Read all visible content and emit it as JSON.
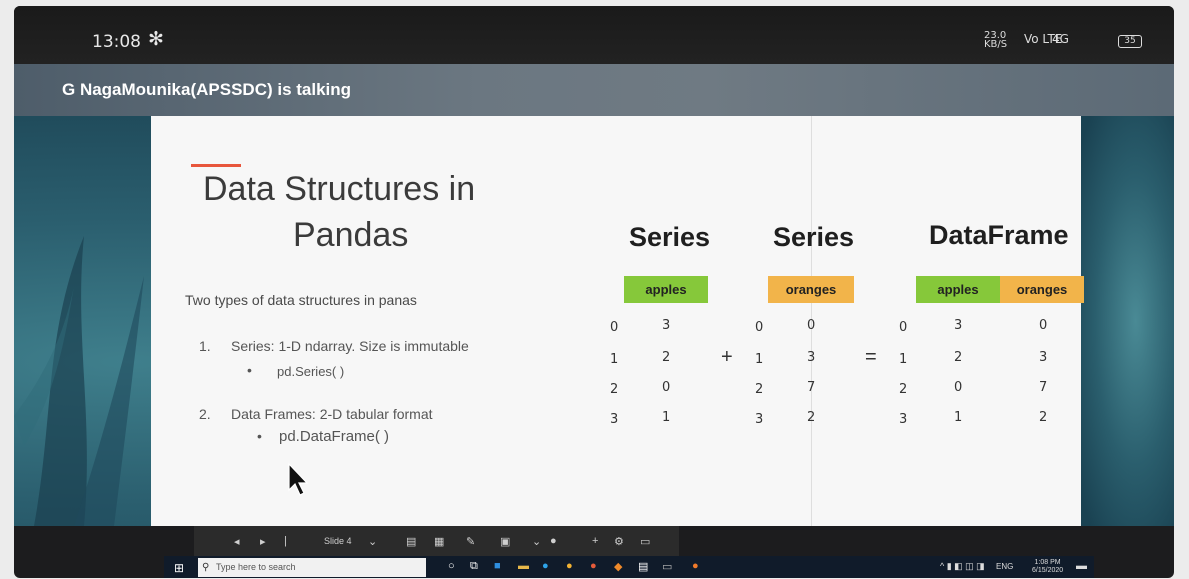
{
  "status_bar": {
    "time": "13:08",
    "net_speed_top": "23.0",
    "net_speed_bottom": "KB/S",
    "signal_1": "Vo LTE",
    "signal_2": "4G",
    "battery": "35"
  },
  "banner": {
    "speaker_text": "G NagaMounika(APSSDC) is talking"
  },
  "slide": {
    "title_line1": "Data Structures in",
    "title_line2": "Pandas",
    "intro": "Two types of data structures in panas",
    "items": [
      {
        "number": "1.",
        "text": "Series: 1-D ndarray. Size is immutable",
        "bullet": "pd.Series( )"
      },
      {
        "number": "2.",
        "text": "Data Frames: 2-D tabular format",
        "bullet": "pd.DataFrame( )"
      }
    ],
    "diagram": {
      "series1_heading": "Series",
      "series2_heading": "Series",
      "dataframe_heading": "DataFrame",
      "series1_column": "apples",
      "series2_column": "oranges",
      "df_columns": [
        "apples",
        "oranges"
      ],
      "plus_sign": "+",
      "equals_sign": "=",
      "index": [
        "0",
        "1",
        "2",
        "3"
      ],
      "apples": [
        "3",
        "2",
        "0",
        "1"
      ],
      "oranges": [
        "0",
        "3",
        "7",
        "2"
      ],
      "bullet_char": "•"
    }
  },
  "presenter_toolbar": {
    "slide_label": "Slide 4"
  },
  "taskbar": {
    "search_placeholder": "Type here to search",
    "clock_time": "1:08 PM",
    "clock_date": "6/15/2020",
    "tray_text": "ENG"
  },
  "colors": {
    "accent": "#e8563c",
    "apples_header": "#86c83a",
    "oranges_header": "#f2b44a"
  }
}
